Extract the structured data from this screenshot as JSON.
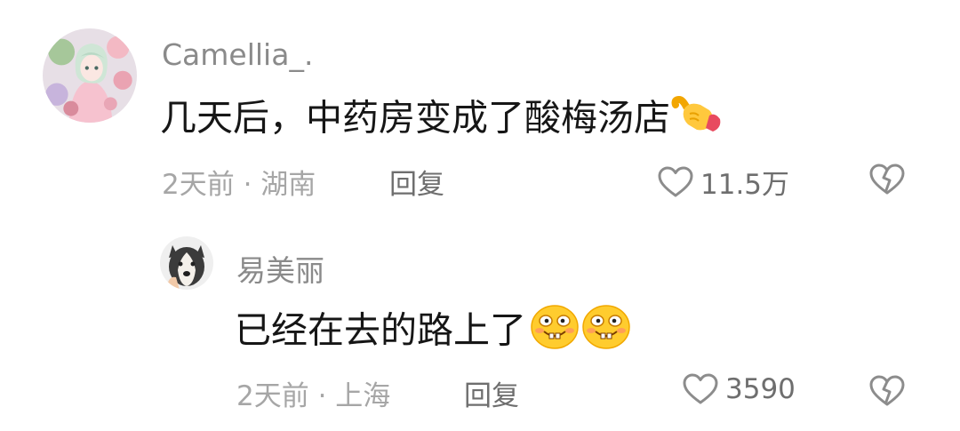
{
  "comments": [
    {
      "username": "Camellia_.",
      "text": "几天后，中药房变成了酸梅汤店",
      "emoji": "pointing-hand-emoji",
      "meta": "2天前 · 湖南",
      "reply_label": "回复",
      "like_count": "11.5万",
      "avatar": "anime-girl-avatar"
    }
  ],
  "replies": [
    {
      "username": "易美丽",
      "text": "已经在去的路上了",
      "emojis": [
        "grin-emoji",
        "grin-emoji"
      ],
      "meta": "2天前 · 上海",
      "reply_label": "回复",
      "like_count": "3590",
      "avatar": "husky-dog-avatar"
    }
  ],
  "colors": {
    "username": "#8a8a8a",
    "text": "#161616",
    "meta": "#a6a6a6",
    "action": "#6e6e6e"
  }
}
